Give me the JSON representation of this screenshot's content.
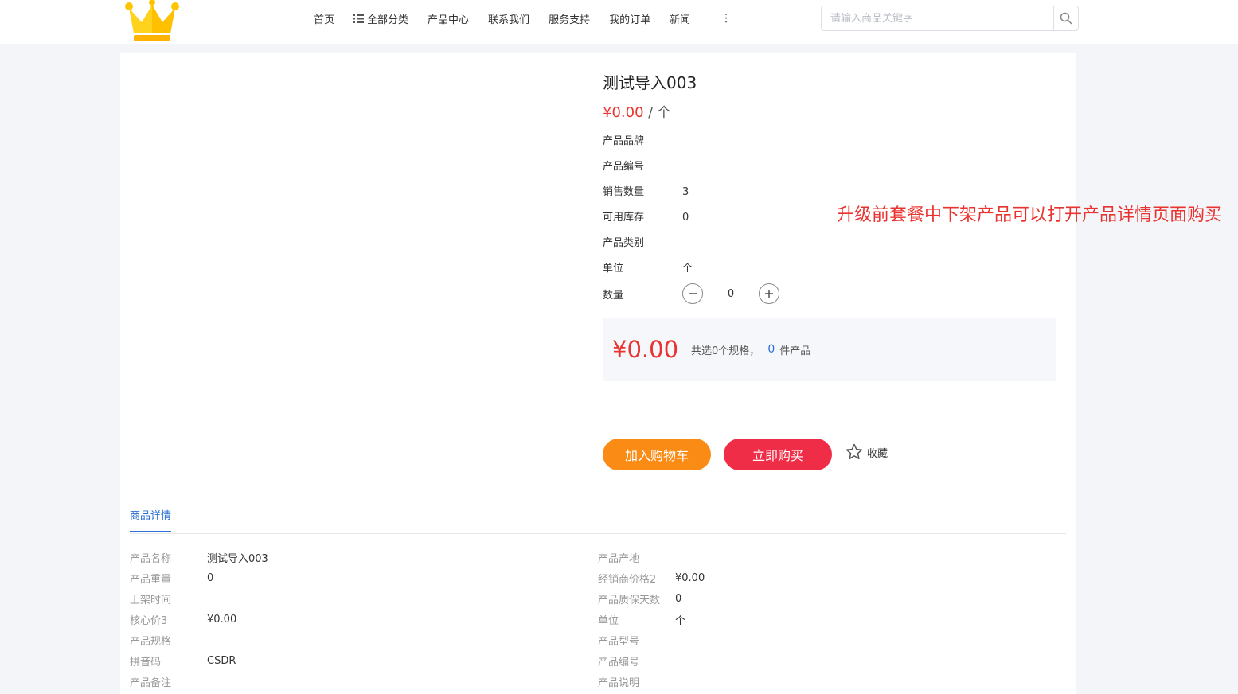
{
  "header": {
    "nav": [
      "首页",
      "全部分类",
      "产品中心",
      "联系我们",
      "服务支持",
      "我的订单",
      "新闻"
    ],
    "more_glyph": "⋮",
    "search_placeholder": "请输入商品关键字"
  },
  "product": {
    "title": "测试导入003",
    "price": "¥0.00",
    "unit_suffix": "/ 个",
    "attributes": [
      {
        "label": "产品品牌",
        "value": ""
      },
      {
        "label": "产品编号",
        "value": ""
      },
      {
        "label": "销售数量",
        "value": "3"
      },
      {
        "label": "可用库存",
        "value": "0"
      },
      {
        "label": "产品类别",
        "value": ""
      },
      {
        "label": "单位",
        "value": "个"
      }
    ],
    "quantity_label": "数量",
    "quantity": "0"
  },
  "summary": {
    "total": "¥0.00",
    "text_before": "共选0个规格，",
    "count": "0",
    "text_after": "件产品"
  },
  "actions": {
    "add_to_cart": "加入购物车",
    "buy_now": "立即购买",
    "favorite": "收藏"
  },
  "annotation": "升级前套餐中下架产品可以打开产品详情页面购买",
  "details": {
    "tab": "商品详情",
    "left": [
      {
        "label": "产品名称",
        "value": "测试导入003"
      },
      {
        "label": "产品重量",
        "value": "0"
      },
      {
        "label": "上架时间",
        "value": ""
      },
      {
        "label": "核心价3",
        "value": "¥0.00"
      },
      {
        "label": "产品规格",
        "value": ""
      },
      {
        "label": "拼音码",
        "value": "CSDR"
      },
      {
        "label": "产品备注",
        "value": ""
      }
    ],
    "right": [
      {
        "label": "产品产地",
        "value": ""
      },
      {
        "label": "经销商价格2",
        "value": "¥0.00"
      },
      {
        "label": "产品质保天数",
        "value": "0"
      },
      {
        "label": "单位",
        "value": "个"
      },
      {
        "label": "产品型号",
        "value": ""
      },
      {
        "label": "产品编号",
        "value": ""
      },
      {
        "label": "产品说明",
        "value": ""
      }
    ]
  },
  "colors": {
    "accent": "#2c6fd6",
    "price": "#e8332f",
    "cart": "#fa8c16",
    "buy": "#ef2d46"
  }
}
